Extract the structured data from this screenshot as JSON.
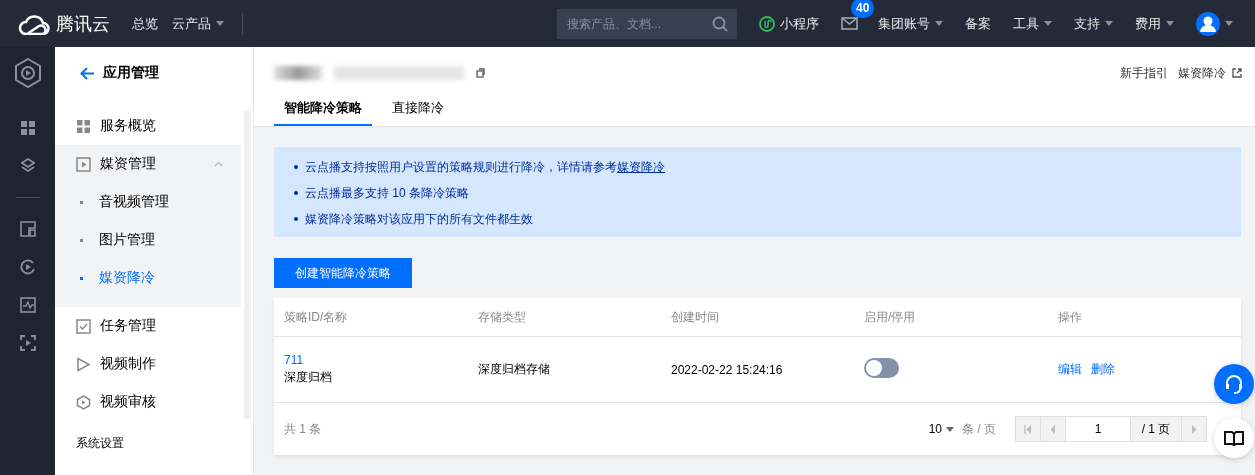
{
  "topbar": {
    "brand": "腾讯云",
    "nav": [
      {
        "label": "总览",
        "dropdown": false
      },
      {
        "label": "云产品",
        "dropdown": true
      }
    ],
    "search": {
      "placeholder": "搜索产品、文档..."
    },
    "right": [
      {
        "label": "小程序",
        "kind": "mini"
      },
      {
        "kind": "mail",
        "badge": "40"
      },
      {
        "label": "集团账号",
        "kind": "menu"
      },
      {
        "label": "备案",
        "kind": "plain"
      },
      {
        "label": "工具",
        "kind": "menu"
      },
      {
        "label": "支持",
        "kind": "menu"
      },
      {
        "label": "费用",
        "kind": "menu"
      },
      {
        "kind": "avatar"
      }
    ]
  },
  "sidebar": {
    "back": "应用管理",
    "items": [
      {
        "label": "服务概览",
        "selected": false
      },
      {
        "label": "媒资管理",
        "selected": false,
        "expanded": true,
        "children": [
          {
            "label": "音视频管理",
            "selected": false
          },
          {
            "label": "图片管理",
            "selected": false
          },
          {
            "label": "媒资降冷",
            "selected": true
          }
        ]
      },
      {
        "label": "任务管理",
        "selected": false
      },
      {
        "label": "视频制作",
        "selected": false
      },
      {
        "label": "视频审核",
        "selected": false
      }
    ],
    "section": "系统设置"
  },
  "header": {
    "links": [
      "新手指引",
      "媒资降冷"
    ],
    "tabs": [
      {
        "label": "智能降冷策略",
        "selected": true
      },
      {
        "label": "直接降冷",
        "selected": false
      }
    ]
  },
  "notice": [
    {
      "text": "云点播支持按照用户设置的策略规则进行降冷，详情请参考",
      "link": "媒资降冷"
    },
    {
      "text": "云点播最多支持 10 条降冷策略"
    },
    {
      "text": "媒资降冷策略对该应用下的所有文件都生效"
    }
  ],
  "create_button": "创建智能降冷策略",
  "table": {
    "columns": [
      "策略ID/名称",
      "存储类型",
      "创建时间",
      "启用/停用",
      "操作"
    ],
    "rows": [
      {
        "id": "711",
        "name": "深度归档",
        "storage": "深度归档存储",
        "created": "2022-02-22 15:24:16",
        "enabled": false,
        "actions": [
          "编辑",
          "删除"
        ]
      }
    ],
    "total": "共 1 条",
    "page_size": "10",
    "per_page": "条 / 页",
    "page": "1",
    "pages": "/ 1 页"
  }
}
